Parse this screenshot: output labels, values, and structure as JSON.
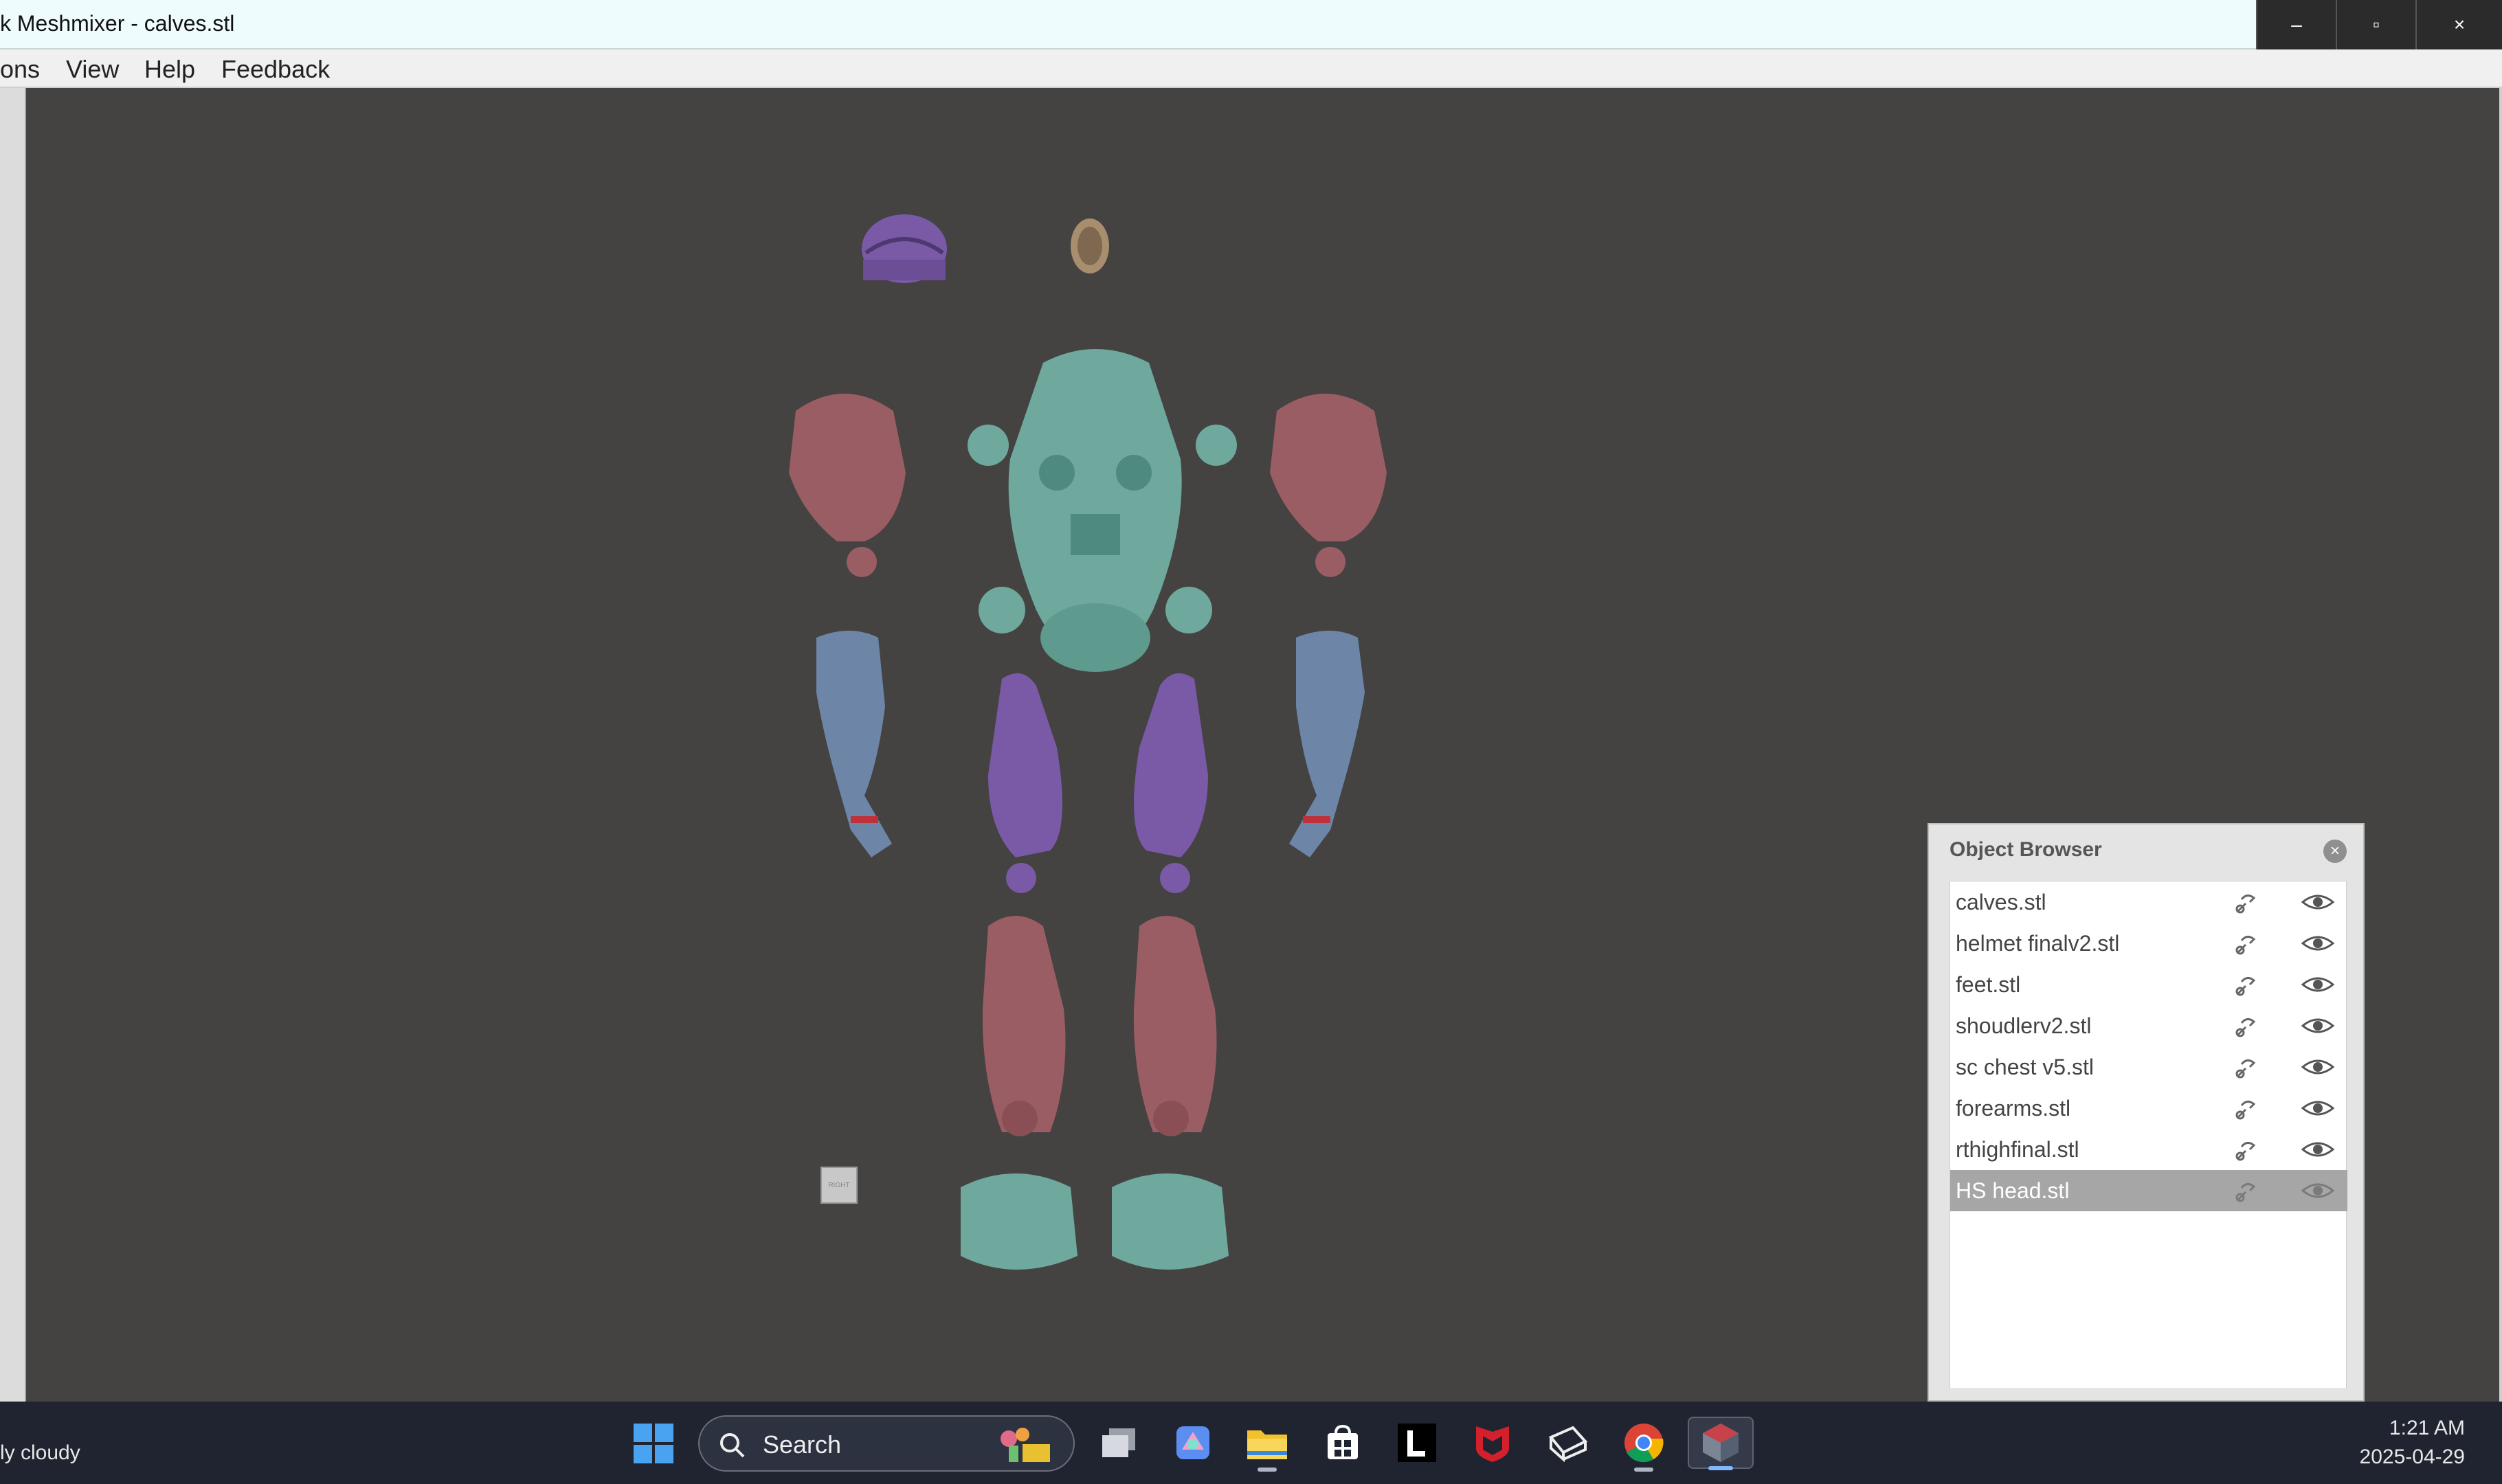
{
  "window": {
    "title": "k Meshmixer - calves.stl",
    "buttons": {
      "minimize": "–",
      "maximize": "▫",
      "close": "×"
    }
  },
  "menu": {
    "items": [
      "ons",
      "View",
      "Help",
      "Feedback"
    ]
  },
  "viewcube": {
    "label": "RIGHT"
  },
  "object_browser": {
    "title": "Object Browser",
    "close_glyph": "×",
    "objects": [
      {
        "name": "calves.stl",
        "selected": false
      },
      {
        "name": "helmet finalv2.stl",
        "selected": false
      },
      {
        "name": "feet.stl",
        "selected": false
      },
      {
        "name": "shoudlerv2.stl",
        "selected": false
      },
      {
        "name": "sc chest v5.stl",
        "selected": false
      },
      {
        "name": "forearms.stl",
        "selected": false
      },
      {
        "name": "rthighfinal.stl",
        "selected": false
      },
      {
        "name": "HS head.stl",
        "selected": true
      }
    ]
  },
  "taskbar": {
    "weather": "ly cloudy",
    "search_label": "Search",
    "time": "1:21 AM",
    "date": "2025-04-29",
    "icons": [
      "start-icon",
      "task-view-icon",
      "copilot-icon",
      "file-explorer-icon",
      "store-icon",
      "l-app-icon",
      "mcafee-icon",
      "toolbox-icon",
      "chrome-icon",
      "meshmixer-icon"
    ]
  },
  "colors": {
    "viewport_bg": "#444342",
    "mesh_teal": "#6fa89c",
    "mesh_rose": "#9a5d63",
    "mesh_purple": "#7a5aa6",
    "mesh_blue": "#6d86a8",
    "mesh_tan": "#a88d6e"
  }
}
